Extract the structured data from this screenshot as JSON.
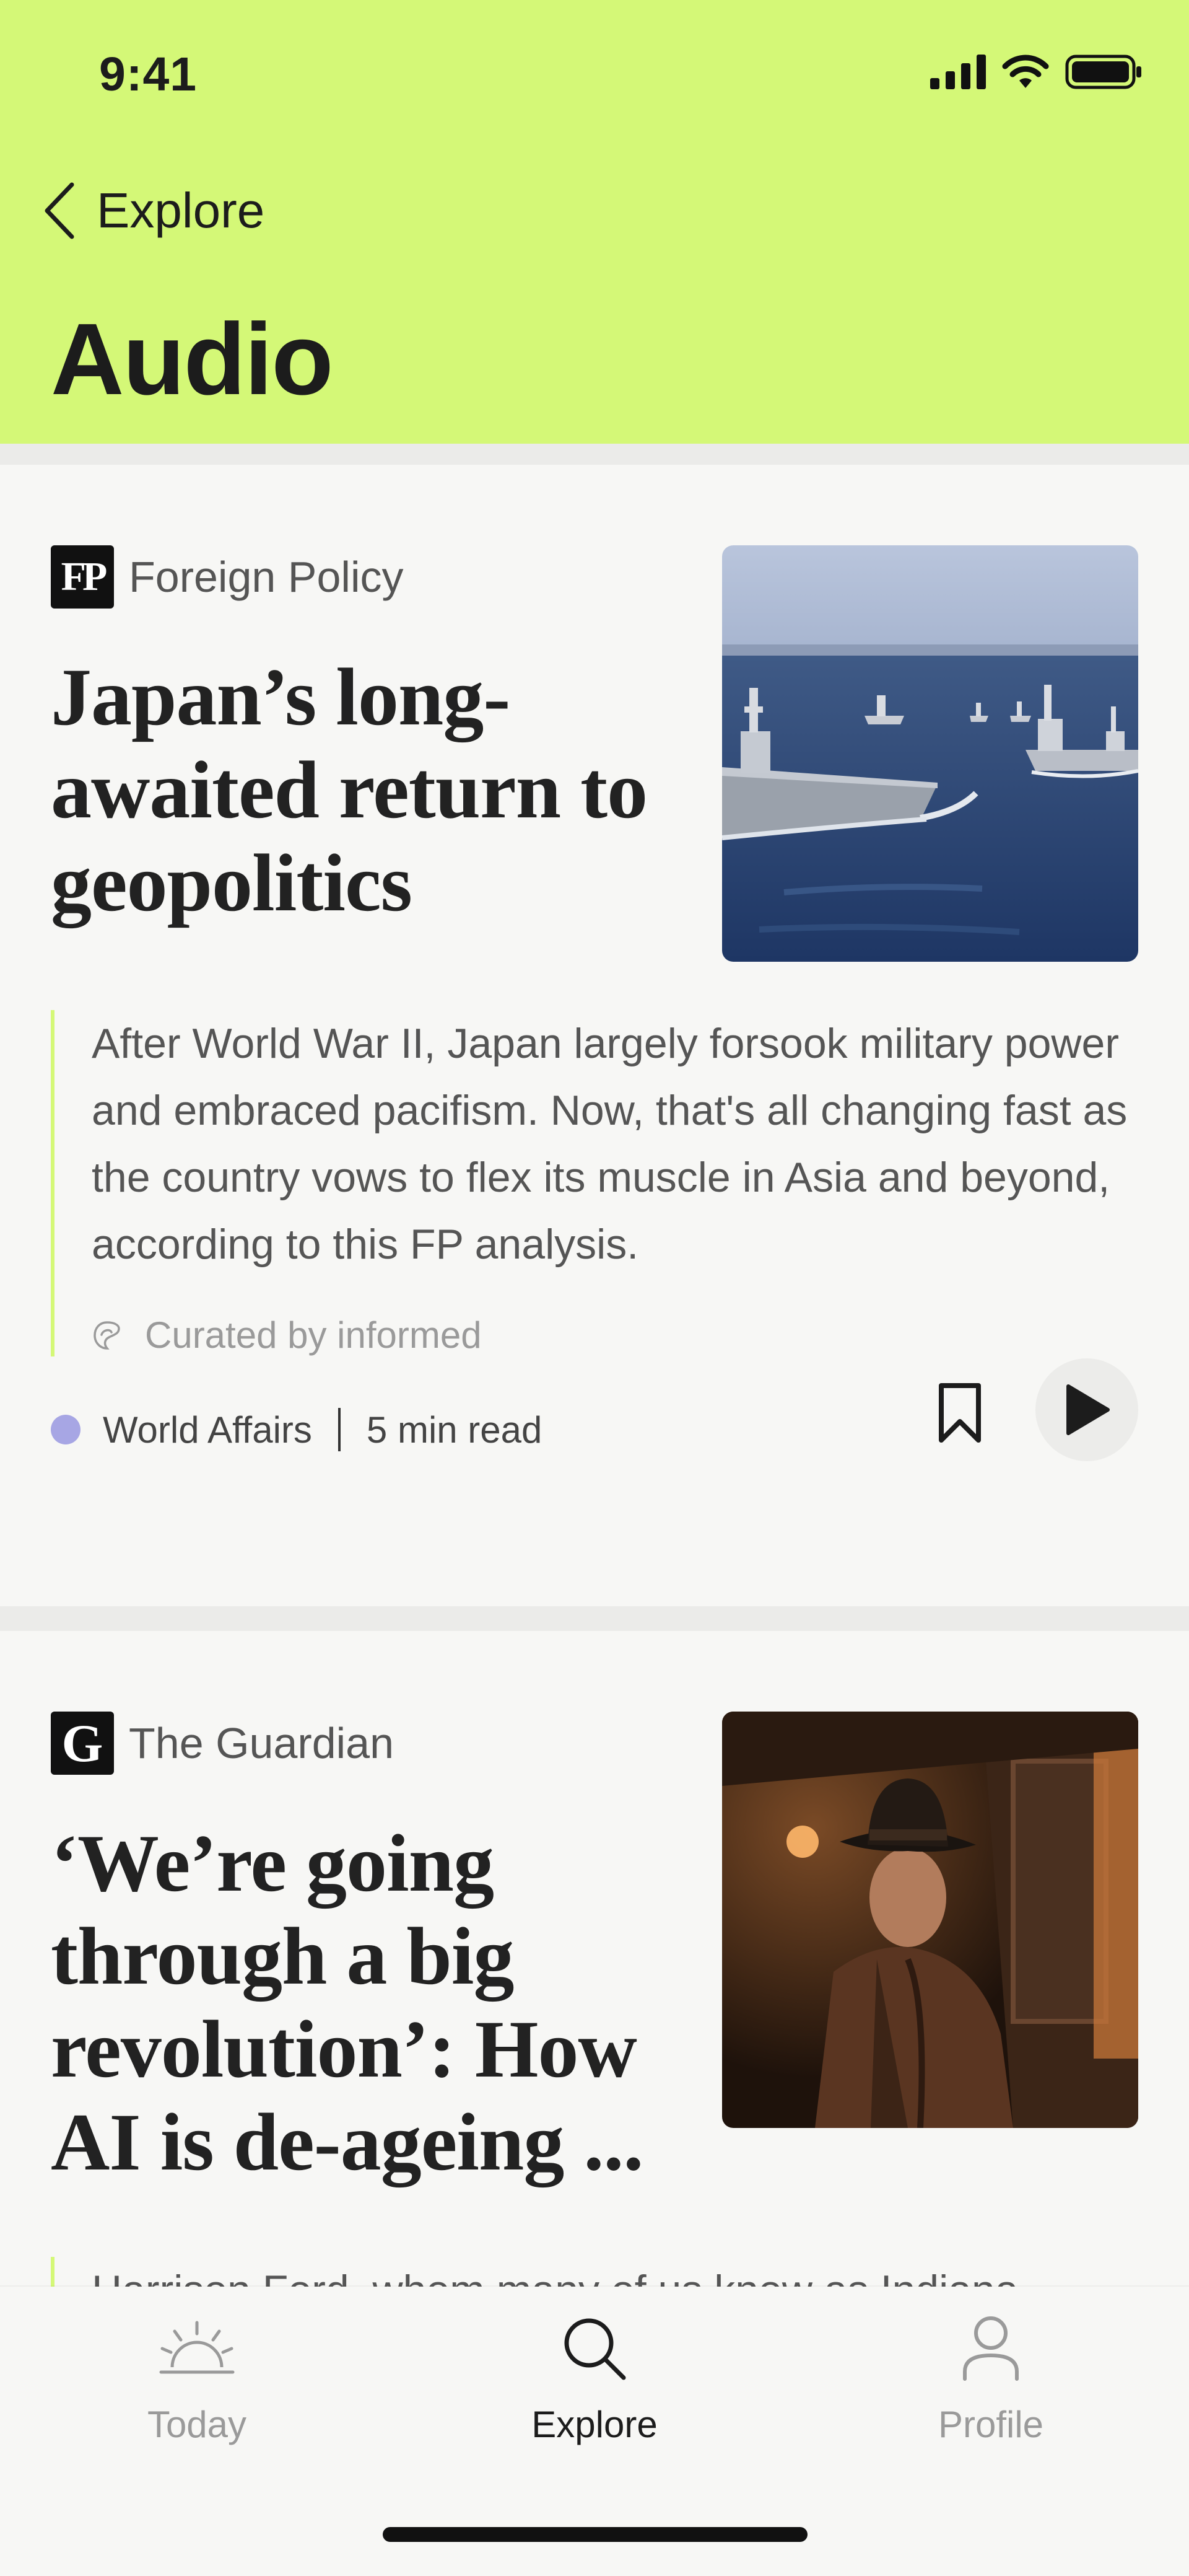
{
  "status_bar": {
    "time": "9:41"
  },
  "nav": {
    "back_label": "Explore"
  },
  "page": {
    "title": "Audio"
  },
  "colors": {
    "accent": "#d4f877",
    "topic_world_affairs": "#a7a6e4",
    "background": "#f7f7f5"
  },
  "articles": [
    {
      "source": "Foreign Policy",
      "source_logo": "FP",
      "headline": "Japan’s long-awaited return to geopolitics",
      "image": "warships-at-sea",
      "summary": "After World War II, Japan largely forsook military power and embraced pacifism. Now, that's all changing fast as the country vows to flex its muscle in Asia and beyond, according to this FP analysis.",
      "curated_by": "Curated by informed",
      "topic": "World Affairs",
      "read_time": "5 min read"
    },
    {
      "source": "The Guardian",
      "source_logo": "G",
      "headline": "‘We’re going through a big revolution’: How AI is de-ageing ...",
      "image": "man-in-fedora-on-train",
      "summary": "Harrison Ford, whom many of us know as Indiana"
    }
  ],
  "tabbar": {
    "items": [
      {
        "label": "Today",
        "icon": "sunrise-icon",
        "active": false
      },
      {
        "label": "Explore",
        "icon": "search-icon",
        "active": true
      },
      {
        "label": "Profile",
        "icon": "person-icon",
        "active": false
      }
    ]
  }
}
